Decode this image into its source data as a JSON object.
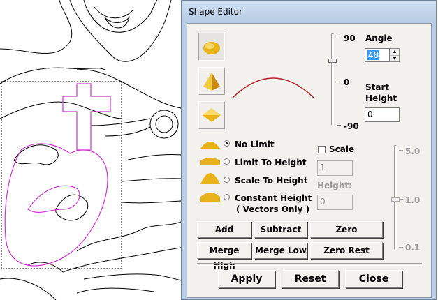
{
  "window": {
    "title": "Shape Editor"
  },
  "angle": {
    "label": "Angle",
    "value": "48",
    "max_label": "90",
    "mid_label": "0",
    "min_label": "-90"
  },
  "start_height": {
    "label_line1": "Start",
    "label_line2": "Height",
    "value": "0"
  },
  "modes": {
    "no_limit": "No Limit",
    "limit_to_height": "Limit To Height",
    "scale_to_height": "Scale To Height",
    "constant_height_line1": "Constant Height",
    "constant_height_line2": "( Vectors Only )",
    "selected": "No Limit"
  },
  "scale": {
    "label": "Scale",
    "checked": false,
    "value": "1",
    "height_label": "Height:",
    "height_value": "0"
  },
  "scale_slider": {
    "top_label": "5.0",
    "mid_label": "1.0",
    "bottom_label": "0.1"
  },
  "buttons": {
    "add": "Add",
    "subtract": "Subtract",
    "zero": "Zero",
    "merge_high": "Merge High",
    "merge_low": "Merge Low",
    "zero_rest": "Zero Rest",
    "apply": "Apply",
    "reset": "Reset",
    "close": "Close"
  },
  "colors": {
    "accent": "#3399ff",
    "profile_curve": "#b3262e",
    "selection_outline": "#cc33cc",
    "shape_gold": "#e8b21a"
  }
}
